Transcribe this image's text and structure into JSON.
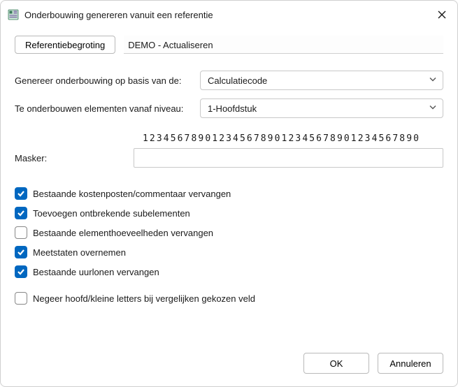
{
  "window": {
    "title": "Onderbouwing genereren vanuit een referentie"
  },
  "reference": {
    "button_label": "Referentiebegroting",
    "value": "DEMO - Actualiseren"
  },
  "fields": {
    "basis_label": "Genereer onderbouwing op basis van de:",
    "basis_value": "Calculatiecode",
    "level_label": "Te onderbouwen elementen vanaf niveau:",
    "level_value": "1-Hoofdstuk"
  },
  "mask": {
    "ruler": "1234567890123456789012345678901234567890",
    "label": "Masker:",
    "value": ""
  },
  "checks": {
    "c1": {
      "label": "Bestaande kostenposten/commentaar vervangen",
      "checked": true
    },
    "c2": {
      "label": "Toevoegen ontbrekende subelementen",
      "checked": true
    },
    "c3": {
      "label": "Bestaande elementhoeveelheden vervangen",
      "checked": false
    },
    "c4": {
      "label": "Meetstaten overnemen",
      "checked": true
    },
    "c5": {
      "label": "Bestaande uurlonen vervangen",
      "checked": true
    },
    "c6": {
      "label": "Negeer hoofd/kleine letters bij vergelijken gekozen veld",
      "checked": false
    }
  },
  "footer": {
    "ok": "OK",
    "cancel": "Annuleren"
  }
}
